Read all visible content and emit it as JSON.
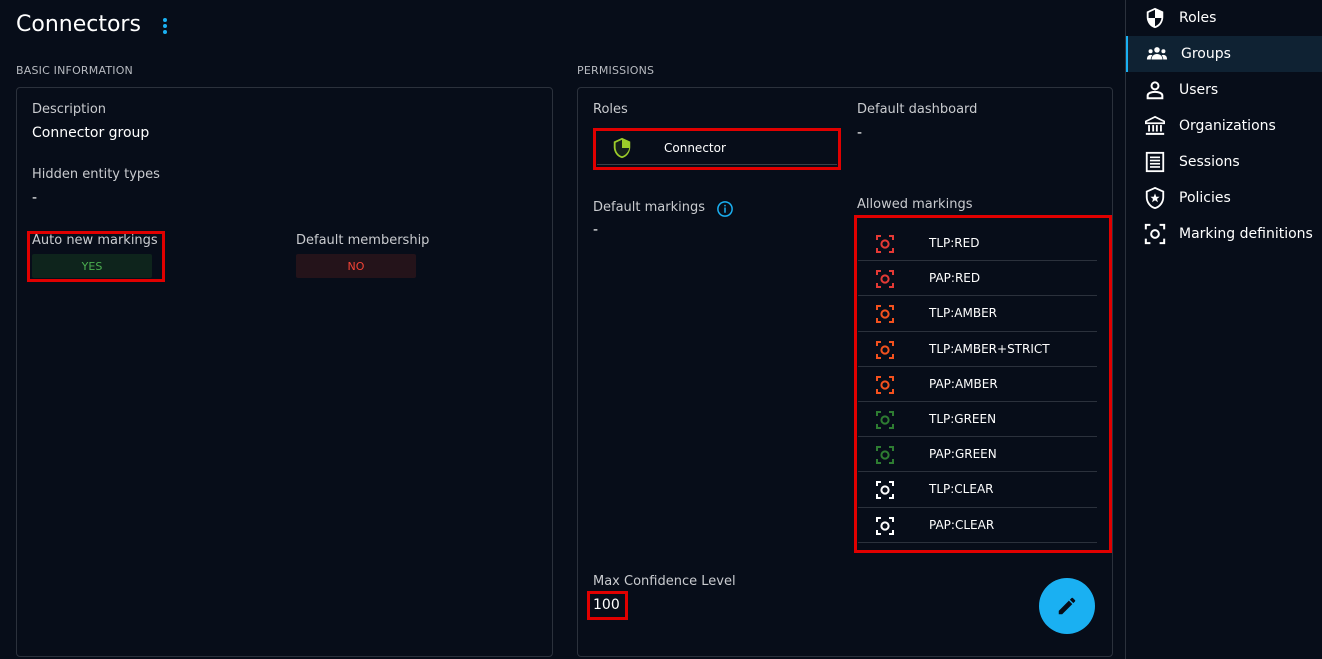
{
  "page": {
    "title": "Connectors"
  },
  "basic": {
    "section_label": "BASIC INFORMATION",
    "description_label": "Description",
    "description_value": "Connector group",
    "hidden_label": "Hidden entity types",
    "hidden_value": "-",
    "auto_label": "Auto new markings",
    "auto_value": "YES",
    "default_membership_label": "Default membership",
    "default_membership_value": "NO"
  },
  "permissions": {
    "section_label": "PERMISSIONS",
    "roles_label": "Roles",
    "role_name": "Connector",
    "default_dashboard_label": "Default dashboard",
    "default_dashboard_value": "-",
    "default_markings_label": "Default markings",
    "default_markings_value": "-",
    "allowed_markings_label": "Allowed markings",
    "allowed_markings": [
      {
        "name": "TLP:RED",
        "color": "#e53935"
      },
      {
        "name": "PAP:RED",
        "color": "#e53935"
      },
      {
        "name": "TLP:AMBER",
        "color": "#f4511e"
      },
      {
        "name": "TLP:AMBER+STRICT",
        "color": "#f4511e"
      },
      {
        "name": "PAP:AMBER",
        "color": "#f4511e"
      },
      {
        "name": "TLP:GREEN",
        "color": "#2e7d32"
      },
      {
        "name": "PAP:GREEN",
        "color": "#2e7d32"
      },
      {
        "name": "TLP:CLEAR",
        "color": "#ffffff"
      },
      {
        "name": "PAP:CLEAR",
        "color": "#ffffff"
      }
    ],
    "max_confidence_label": "Max Confidence Level",
    "max_confidence_value": "100"
  },
  "sidebar": {
    "items": [
      {
        "label": "Roles",
        "icon": "shield-icon"
      },
      {
        "label": "Groups",
        "icon": "group-icon"
      },
      {
        "label": "Users",
        "icon": "user-icon"
      },
      {
        "label": "Organizations",
        "icon": "bank-icon"
      },
      {
        "label": "Sessions",
        "icon": "list-icon"
      },
      {
        "label": "Policies",
        "icon": "shield-star-icon"
      },
      {
        "label": "Marking definitions",
        "icon": "marking-icon"
      }
    ]
  },
  "colors": {
    "accent": "#1ab0f2",
    "yes": "#4caf50",
    "no": "#f44336",
    "role_shield": "#9ccc2a"
  }
}
